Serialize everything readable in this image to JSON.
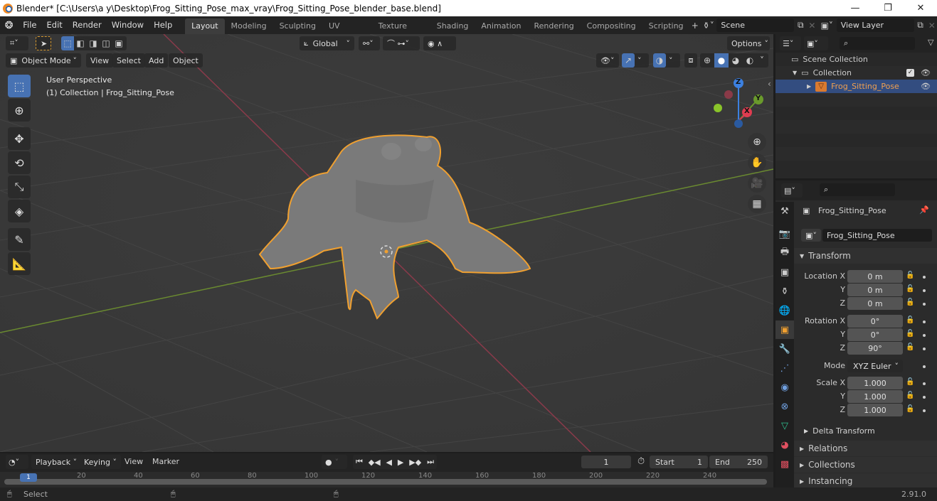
{
  "window": {
    "title": "Blender* [C:\\Users\\a y\\Desktop\\Frog_Sitting_Pose_max_vray\\Frog_Sitting_Pose_blender_base.blend]",
    "minimize_icon": "minimize-icon",
    "restore_icon": "restore-icon",
    "close_icon": "close-icon"
  },
  "menu": [
    "File",
    "Edit",
    "Render",
    "Window",
    "Help"
  ],
  "workspaces": [
    {
      "label": "Layout",
      "active": true
    },
    {
      "label": "Modeling"
    },
    {
      "label": "Sculpting"
    },
    {
      "label": "UV Editing"
    },
    {
      "label": "Texture Paint"
    },
    {
      "label": "Shading"
    },
    {
      "label": "Animation"
    },
    {
      "label": "Rendering"
    },
    {
      "label": "Compositing"
    },
    {
      "label": "Scripting"
    }
  ],
  "scene": {
    "name": "Scene",
    "view_layer": "View Layer"
  },
  "viewport": {
    "orientation": "Global",
    "options_label": "Options",
    "mode": "Object Mode",
    "menus": [
      "View",
      "Select",
      "Add",
      "Object"
    ],
    "overlay_line1": "User Perspective",
    "overlay_line2": "(1) Collection | Frog_Sitting_Pose",
    "gizmo": {
      "x": "X",
      "y": "Y",
      "z": "Z"
    }
  },
  "outliner": {
    "items": [
      {
        "label": "Scene Collection",
        "level": 0
      },
      {
        "label": "Collection",
        "level": 1,
        "checked": true,
        "visible": true
      },
      {
        "label": "Frog_Sitting_Pose",
        "level": 2,
        "selected": true,
        "visible": true
      }
    ]
  },
  "properties": {
    "object_name": "Frog_Sitting_Pose",
    "datablock_name": "Frog_Sitting_Pose",
    "transform_label": "Transform",
    "location": {
      "label": "Location",
      "x": "0 m",
      "y": "0 m",
      "z": "0 m"
    },
    "rotation": {
      "label": "Rotation",
      "x": "0°",
      "y": "0°",
      "z": "90°"
    },
    "mode": {
      "label": "Mode",
      "value": "XYZ Euler"
    },
    "scale": {
      "label": "Scale",
      "x": "1.000",
      "y": "1.000",
      "z": "1.000"
    },
    "axis": {
      "x": "X",
      "y": "Y",
      "z": "Z"
    },
    "subsections": [
      "Delta Transform"
    ],
    "sections": [
      "Relations",
      "Collections",
      "Instancing"
    ]
  },
  "timeline": {
    "menus": [
      "Playback",
      "Keying",
      "View",
      "Marker"
    ],
    "current_frame": "1",
    "start_label": "Start",
    "start": "1",
    "end_label": "End",
    "end": "250",
    "ticks": [
      "1",
      "20",
      "40",
      "60",
      "80",
      "100",
      "120",
      "140",
      "160",
      "180",
      "200",
      "220",
      "240"
    ]
  },
  "status": {
    "left": "Select",
    "version": "2.91.0"
  },
  "colors": {
    "accent": "#4772b3",
    "selection": "#f0a030",
    "x_axis": "#b03c50",
    "y_axis": "#6a9a2c",
    "z_axis": "#3c80e0"
  }
}
